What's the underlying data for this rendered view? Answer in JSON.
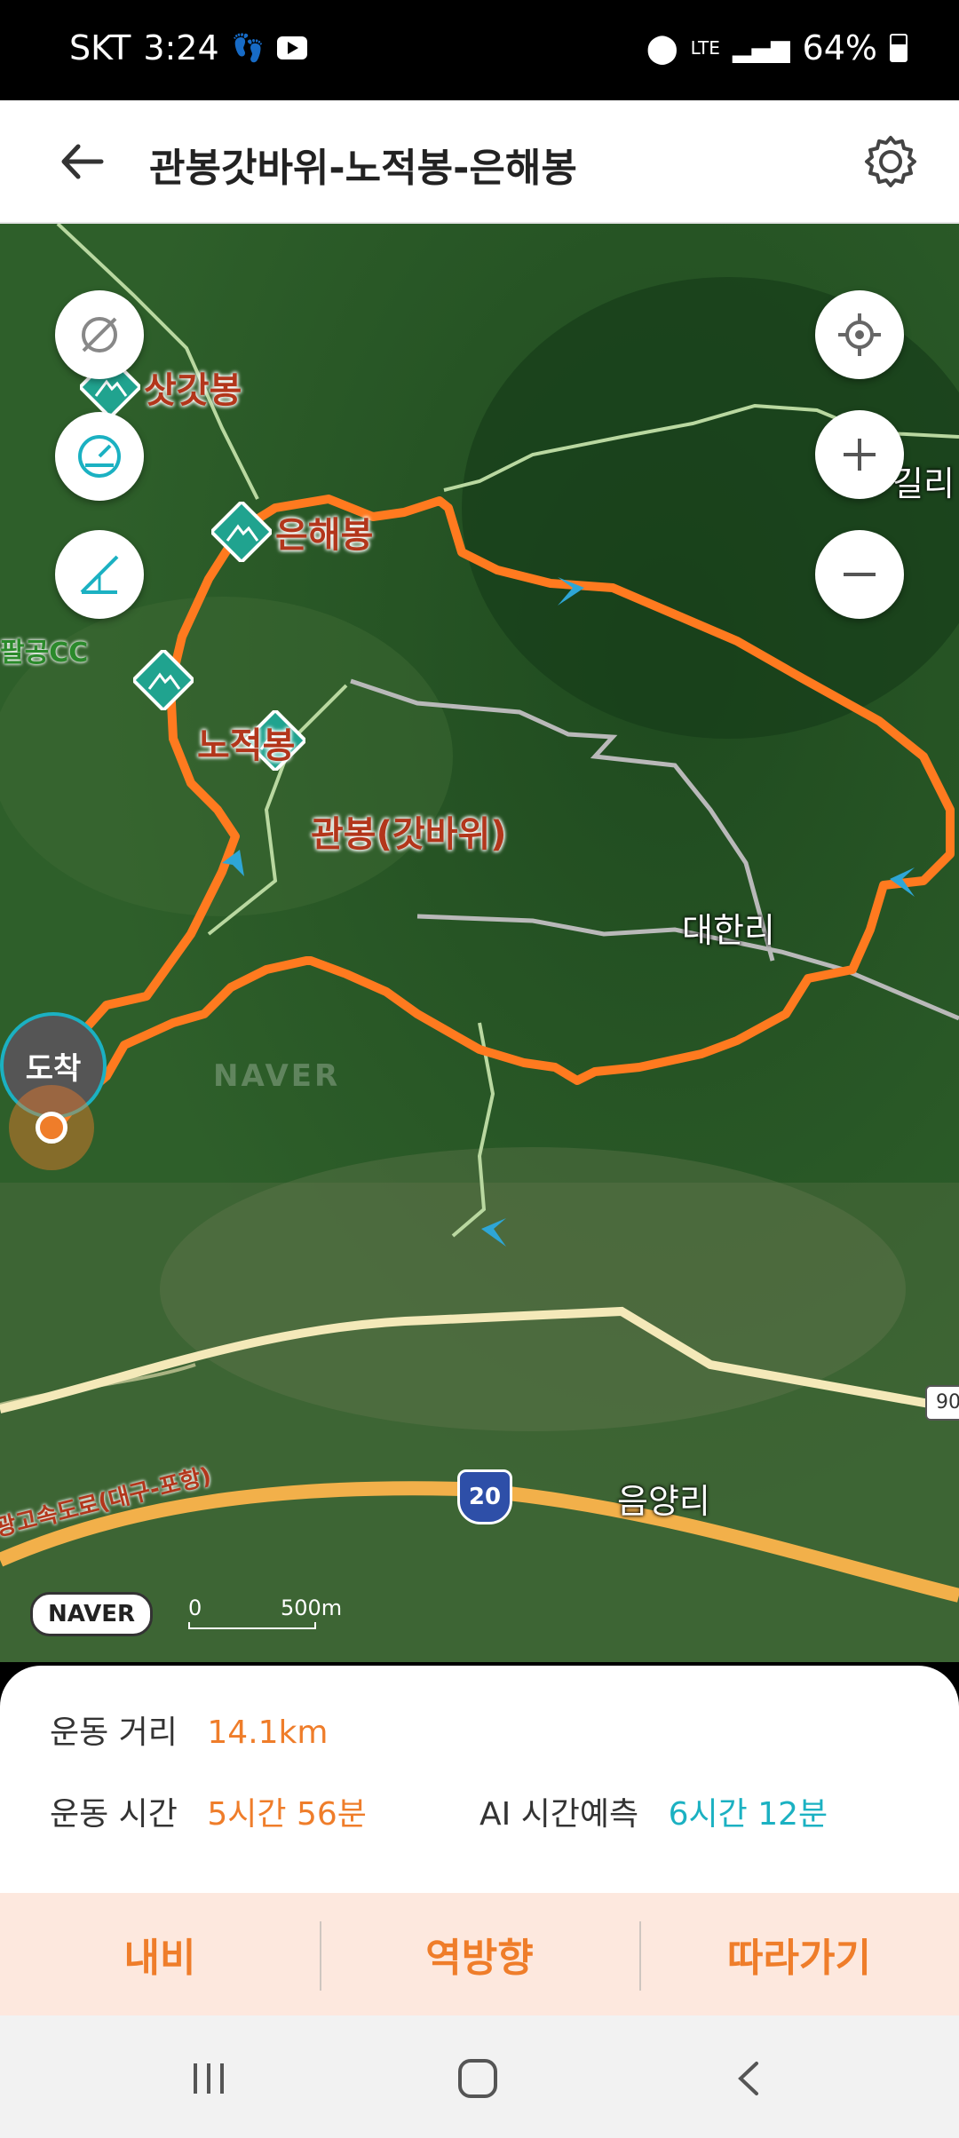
{
  "status_bar": {
    "carrier": "SKT",
    "time": "3:24",
    "network": "LTE",
    "battery": "64%"
  },
  "header": {
    "title": "관봉갓바위-노적봉-은해봉"
  },
  "map": {
    "peaks": [
      "삿갓봉",
      "은해봉",
      "노적봉",
      "관봉(갓바위)"
    ],
    "places": [
      "대한리",
      "음양리",
      "팔공CC"
    ],
    "road_labels": [
      "20",
      "90",
      "광고속도로(대구-포항)",
      "길리"
    ],
    "arrive_label": "도착",
    "scale_zero": "0",
    "scale_dist": "500m",
    "logo": "NAVER",
    "watermark": "NAVER"
  },
  "stats": {
    "distance_label": "운동 거리",
    "distance_value": "14.1km",
    "time_label": "운동 시간",
    "time_value": "5시간 56분",
    "ai_label": "AI 시간예측",
    "ai_value": "6시간 12분"
  },
  "actions": {
    "navi": "내비",
    "reverse": "역방향",
    "follow": "따라가기"
  },
  "colors": {
    "route": "#ff7a1f",
    "accent_orange": "#ef7d2a",
    "accent_teal": "#1bb1c2",
    "peak_marker": "#20a38f"
  }
}
